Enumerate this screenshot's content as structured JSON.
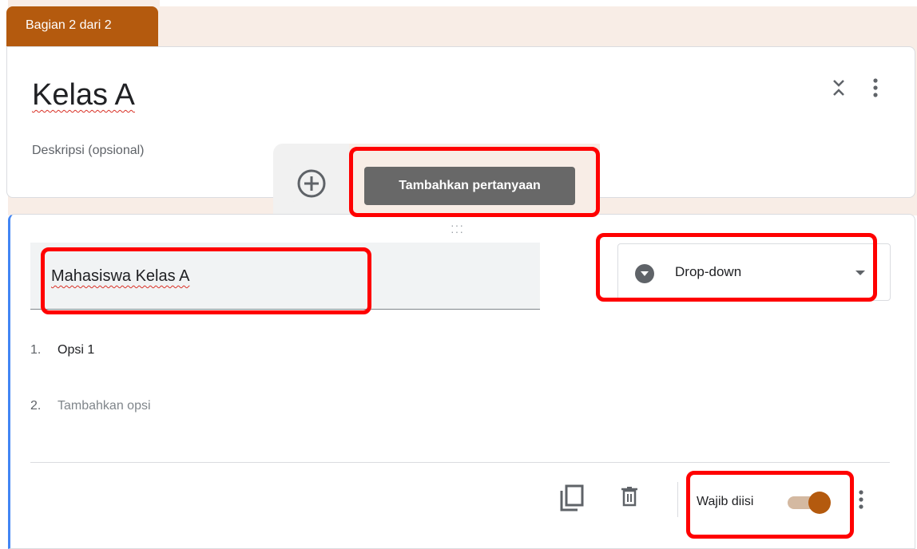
{
  "section": {
    "tab_label": "Bagian 2 dari 2",
    "title": "Kelas A",
    "description_placeholder": "Deskripsi (opsional)",
    "collapse_icon": "unfold-less-icon",
    "more_icon": "more-vert-icon"
  },
  "floating": {
    "add_icon": "add-circle-icon",
    "tooltip": "Tambahkan pertanyaan"
  },
  "question": {
    "title": "Mahasiswa Kelas A",
    "type_icon": "dropdown-circle-icon",
    "type_label": "Drop-down",
    "options": [
      {
        "number": "1.",
        "label": "Opsi 1"
      },
      {
        "number": "2.",
        "label": "Tambahkan opsi"
      }
    ],
    "footer": {
      "copy_icon": "duplicate-icon",
      "delete_icon": "trash-icon",
      "required_label": "Wajib diisi",
      "required_on": true,
      "more_icon": "more-vert-icon"
    }
  },
  "colors": {
    "accent": "#b45a0e",
    "page_background": "#f8ede6",
    "left_border": "#4285f4",
    "highlight": "#ff0000",
    "tooltip_background": "#686868"
  }
}
